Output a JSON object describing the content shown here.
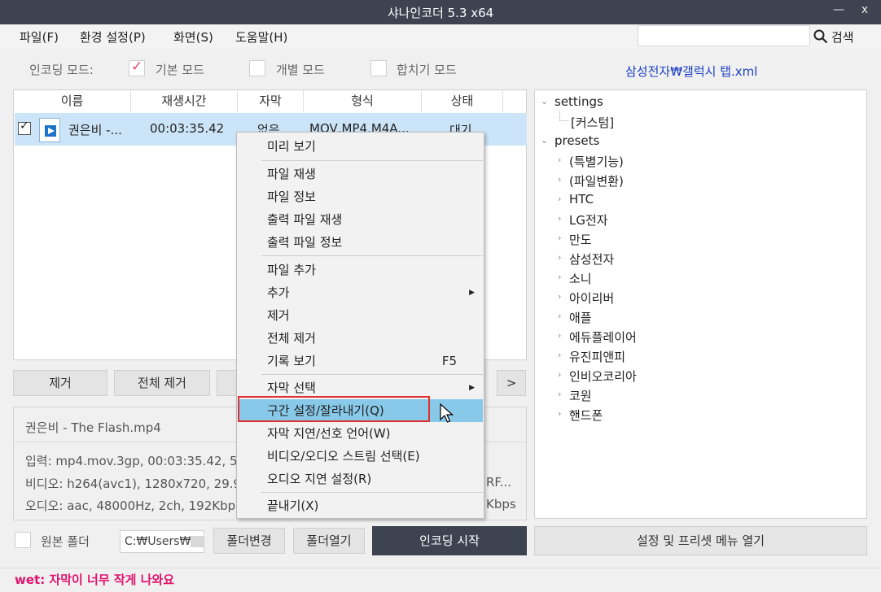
{
  "window": {
    "title": "샤나인코더  5.3  x64",
    "minimize": "—",
    "close": "x"
  },
  "menu": [
    {
      "label": "파일(F)"
    },
    {
      "label": "환경 설정(P)"
    },
    {
      "label": "화면(S)"
    },
    {
      "label": "도움말(H)"
    }
  ],
  "search": {
    "value": "",
    "button": "검색"
  },
  "mode": {
    "label": "인코딩 모드:",
    "basic": "기본 모드",
    "individual": "개별 모드",
    "merge": "합치기 모드",
    "basic_checked": true
  },
  "preset_file": "삼성전자₩갤럭시 탭.xml",
  "list": {
    "headers": [
      "이름",
      "재생시간",
      "자막",
      "형식",
      "상태"
    ],
    "rows": [
      {
        "name": "권은비 -...",
        "duration": "00:03:35.42",
        "subtitle": "없음",
        "format": "MOV,MP4,M4A...",
        "status": "대기"
      }
    ]
  },
  "list_buttons": {
    "remove": "제거",
    "remove_all": "전체 제거",
    "next": ">"
  },
  "info": {
    "filename": "권은비 - The Flash.mp4",
    "input": "입력: mp4.mov.3gp, 00:03:35.42, 5",
    "video": "비디오: h264(avc1), 1280x720, 29.9",
    "audio": "오디오: aac, 48000Hz, 2ch, 192Kbp",
    "video_tail": "RF...",
    "audio_tail": "Kbps"
  },
  "tree": {
    "settings": "settings",
    "custom": "[커스텀]",
    "presets": "presets",
    "items": [
      "(특별기능)",
      "(파일변환)",
      "HTC",
      "LG전자",
      "만도",
      "삼성전자",
      "소니",
      "아이리버",
      "애플",
      "에듀플레이어",
      "유진피앤피",
      "인비오코리아",
      "코원",
      "핸드폰"
    ]
  },
  "folder": {
    "source_label": "원본 폴더",
    "path": "C:₩Users₩",
    "change": "폴더변경",
    "open": "폴더열기"
  },
  "encode_button": "인코딩 시작",
  "settings_button": "설정 및 프리셋 메뉴 열기",
  "status": "wet: 자막이 너무 작게 나와요",
  "context_menu": {
    "preview": "미리 보기",
    "play": "파일 재생",
    "info": "파일 정보",
    "out_play": "출력 파일 재생",
    "out_info": "출력 파일 정보",
    "add_file": "파일 추가",
    "add": "추가",
    "remove": "제거",
    "remove_all": "전체 제거",
    "history": "기록 보기",
    "history_key": "F5",
    "sub_select": "자막 선택",
    "trim": "구간 설정/잘라내기(Q)",
    "sub_delay": "자막 지연/선호 언어(W)",
    "stream": "비디오/오디오 스트림 선택(E)",
    "audio_delay": "오디오 지연 설정(R)",
    "exit": "끝내기(X)"
  }
}
